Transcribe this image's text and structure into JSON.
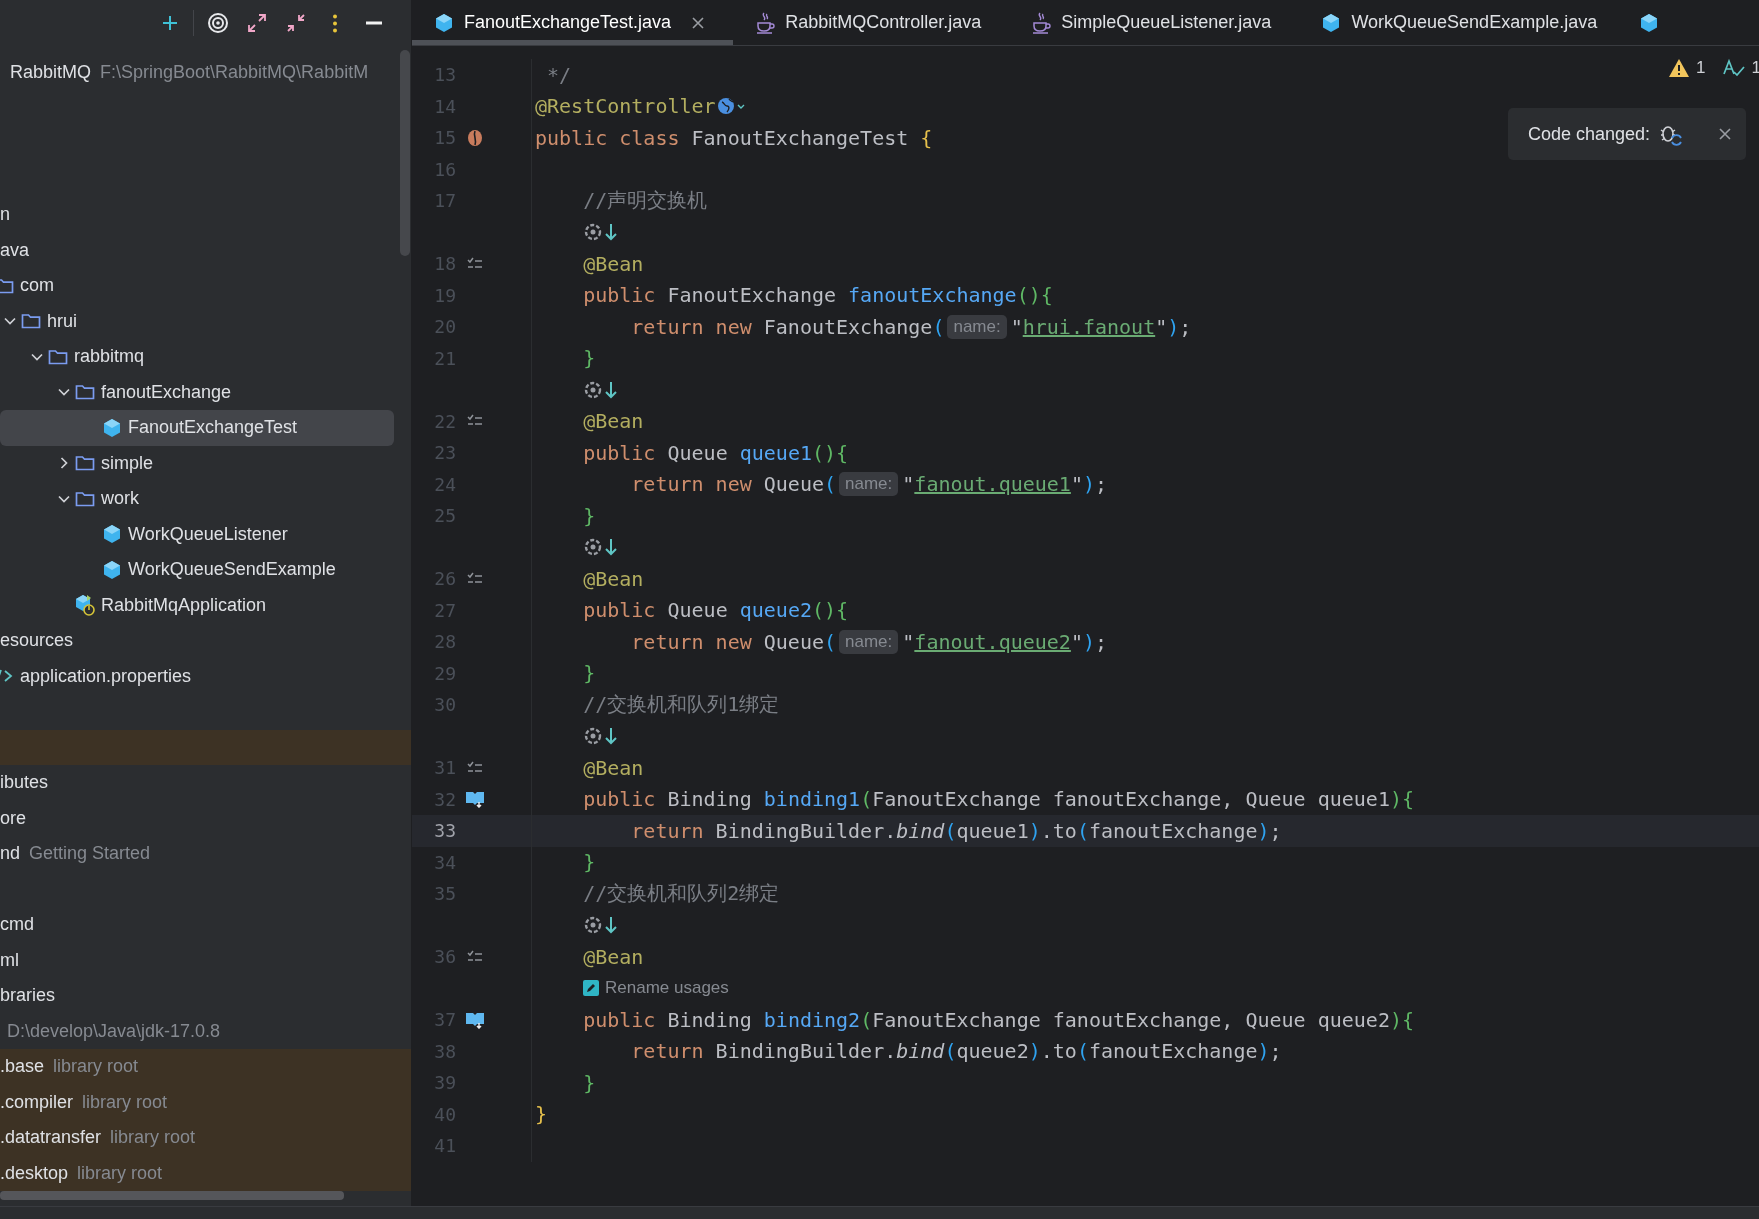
{
  "project": {
    "root": {
      "label": "RabbitMQ",
      "detail": "F:\\SpringBoot\\RabbitMQ\\RabbitM"
    },
    "rows": [
      {
        "excluded": false
      },
      {
        "excluded": false
      },
      {
        "excluded": false
      },
      {
        "label": "n",
        "selected": false,
        "children": [
          {
            "label": "ava",
            "selected": false,
            "children": [
              {
                "label": "com",
                "kind": "folder",
                "selected": false,
                "children": [
                  {
                    "label": "hrui",
                    "kind": "folder",
                    "expanded": true,
                    "selected": false,
                    "children": [
                      {
                        "label": "rabbitmq",
                        "kind": "folder",
                        "expanded": true,
                        "selected": false,
                        "children": [
                          {
                            "label": "fanoutExchange",
                            "kind": "folder",
                            "expanded": true,
                            "selected": false,
                            "children": [
                              {
                                "label": "FanoutExchangeTest",
                                "kind": "class",
                                "selected": true
                              }
                            ]
                          },
                          {
                            "label": "simple",
                            "kind": "folder",
                            "expanded": false,
                            "selected": false
                          },
                          {
                            "label": "work",
                            "kind": "folder",
                            "expanded": true,
                            "selected": false,
                            "children": [
                              {
                                "label": "WorkQueueListener",
                                "kind": "class",
                                "selected": false
                              },
                              {
                                "label": "WorkQueueSendExample",
                                "kind": "class",
                                "selected": false
                              }
                            ]
                          },
                          {
                            "label": "RabbitMqApplication",
                            "kind": "app",
                            "selected": false
                          }
                        ]
                      }
                    ]
                  }
                ]
              }
            ]
          },
          {
            "label": "esources",
            "selected": false,
            "children": [
              {
                "label": "application.properties",
                "kind": "properties",
                "selected": false
              }
            ]
          }
        ]
      },
      {
        "excluded": false
      },
      {
        "excluded": true
      },
      {
        "label": "ibutes",
        "selected": false
      },
      {
        "label": "ore",
        "selected": false
      },
      {
        "label": "nd",
        "detail": "Getting Started",
        "selected": false
      },
      {
        "excluded": false
      },
      {
        "label": "cmd",
        "selected": false
      },
      {
        "label": "ml",
        "selected": false
      },
      {
        "label": "braries",
        "selected": false
      },
      {
        "detail": "D:\\develop\\Java\\jdk-17.0.8",
        "selected": false
      },
      {
        "label": ".base",
        "detail": "library root",
        "excluded": true,
        "selected": false
      },
      {
        "label": ".compiler",
        "detail": "library root",
        "excluded": true,
        "selected": false
      },
      {
        "label": ".datatransfer",
        "detail": "library root",
        "excluded": true,
        "selected": false
      },
      {
        "label": ".desktop",
        "detail": "library root",
        "excluded": true,
        "selected": false
      }
    ]
  },
  "editor": {
    "tabs": [
      {
        "label": "FanoutExchangeTest.java",
        "kind": "class",
        "selected": true,
        "closable": true
      },
      {
        "label": "RabbitMQController.java",
        "kind": "java",
        "selected": false,
        "closable": false
      },
      {
        "label": "SimpleQueueListener.java",
        "kind": "java",
        "selected": false,
        "closable": false
      },
      {
        "label": "WorkQueueSendExample.java",
        "kind": "class",
        "selected": false,
        "closable": false
      },
      {
        "kind": "class",
        "selected": false,
        "closable": false
      }
    ],
    "inspections": [
      {
        "kind": "warning",
        "count": "1"
      },
      {
        "kind": "typo",
        "count": "1"
      }
    ],
    "notification": {
      "text": "Code changed:"
    },
    "lines": [
      {
        "number": "13",
        "tokens": [
          {
            "kind": "comment",
            "text": " */"
          }
        ]
      },
      {
        "number": "14",
        "tokens": [
          {
            "kind": "ann",
            "text": "@RestController"
          },
          {
            "kind": "web-icon"
          }
        ]
      },
      {
        "number": "15",
        "gutter": {
          "kind": "bean"
        },
        "tokens": [
          {
            "kind": "kw",
            "text": "public"
          },
          {
            "kind": "kw",
            "text": " class"
          },
          {
            "kind": "plain",
            "text": " FanoutExchangeTest "
          },
          {
            "kind": "b1",
            "text": "{"
          }
        ]
      },
      {
        "number": "16"
      },
      {
        "number": "17",
        "tokens": [
          {
            "kind": "comment",
            "text": "    //声明交换机"
          }
        ]
      },
      {
        "kind": "inlay"
      },
      {
        "number": "18",
        "gutter": {
          "kind": "list"
        },
        "tokens": [
          {
            "kind": "ann",
            "text": "    @Bean"
          }
        ]
      },
      {
        "number": "19",
        "tokens": [
          {
            "kind": "kw",
            "text": "    public"
          },
          {
            "kind": "plain",
            "text": " FanoutExchange "
          },
          {
            "kind": "fn",
            "text": "fanoutExchange"
          },
          {
            "kind": "b2",
            "text": "(){"
          }
        ]
      },
      {
        "number": "20",
        "tokens": [
          {
            "kind": "kw",
            "text": "        return"
          },
          {
            "kind": "kw",
            "text": " new"
          },
          {
            "kind": "plain",
            "text": " FanoutExchange"
          },
          {
            "kind": "b3",
            "text": "("
          },
          {
            "kind": "hint",
            "text": "name:"
          },
          {
            "kind": "plain",
            "text": "\""
          },
          {
            "kind": "link",
            "text": "hrui.fanout"
          },
          {
            "kind": "plain",
            "text": "\""
          },
          {
            "kind": "b3",
            "text": ")"
          },
          {
            "kind": "plain",
            "text": ";"
          }
        ]
      },
      {
        "number": "21",
        "tokens": [
          {
            "kind": "b2",
            "text": "    }"
          }
        ]
      },
      {
        "kind": "inlay"
      },
      {
        "number": "22",
        "gutter": {
          "kind": "list"
        },
        "tokens": [
          {
            "kind": "ann",
            "text": "    @Bean"
          }
        ]
      },
      {
        "number": "23",
        "tokens": [
          {
            "kind": "kw",
            "text": "    public"
          },
          {
            "kind": "plain",
            "text": " Queue "
          },
          {
            "kind": "fn",
            "text": "queue1"
          },
          {
            "kind": "b2",
            "text": "(){"
          }
        ]
      },
      {
        "number": "24",
        "tokens": [
          {
            "kind": "kw",
            "text": "        return"
          },
          {
            "kind": "kw",
            "text": " new"
          },
          {
            "kind": "plain",
            "text": " Queue"
          },
          {
            "kind": "b3",
            "text": "("
          },
          {
            "kind": "hint",
            "text": "name:"
          },
          {
            "kind": "plain",
            "text": "\""
          },
          {
            "kind": "link",
            "text": "fanout.queue1"
          },
          {
            "kind": "plain",
            "text": "\""
          },
          {
            "kind": "b3",
            "text": ")"
          },
          {
            "kind": "plain",
            "text": ";"
          }
        ]
      },
      {
        "number": "25",
        "tokens": [
          {
            "kind": "b2",
            "text": "    }"
          }
        ]
      },
      {
        "kind": "inlay"
      },
      {
        "number": "26",
        "gutter": {
          "kind": "list"
        },
        "tokens": [
          {
            "kind": "ann",
            "text": "    @Bean"
          }
        ]
      },
      {
        "number": "27",
        "tokens": [
          {
            "kind": "kw",
            "text": "    public"
          },
          {
            "kind": "plain",
            "text": " Queue "
          },
          {
            "kind": "fn",
            "text": "queue2"
          },
          {
            "kind": "b2",
            "text": "(){"
          }
        ]
      },
      {
        "number": "28",
        "tokens": [
          {
            "kind": "kw",
            "text": "        return"
          },
          {
            "kind": "kw",
            "text": " new"
          },
          {
            "kind": "plain",
            "text": " Queue"
          },
          {
            "kind": "b3",
            "text": "("
          },
          {
            "kind": "hint",
            "text": "name:"
          },
          {
            "kind": "plain",
            "text": "\""
          },
          {
            "kind": "link",
            "text": "fanout.queue2"
          },
          {
            "kind": "plain",
            "text": "\""
          },
          {
            "kind": "b3",
            "text": ")"
          },
          {
            "kind": "plain",
            "text": ";"
          }
        ]
      },
      {
        "number": "29",
        "tokens": [
          {
            "kind": "b2",
            "text": "    }"
          }
        ]
      },
      {
        "number": "30",
        "tokens": [
          {
            "kind": "comment",
            "text": "    //交换机和队列1绑定"
          }
        ]
      },
      {
        "kind": "inlay"
      },
      {
        "number": "31",
        "gutter": {
          "kind": "list"
        },
        "tokens": [
          {
            "kind": "ann",
            "text": "    @Bean"
          }
        ]
      },
      {
        "number": "32",
        "gutter": {
          "kind": "book"
        },
        "tokens": [
          {
            "kind": "kw",
            "text": "    public"
          },
          {
            "kind": "plain",
            "text": " Binding "
          },
          {
            "kind": "fn",
            "text": "binding1"
          },
          {
            "kind": "b2",
            "text": "("
          },
          {
            "kind": "plain",
            "text": "FanoutExchange fanoutExchange, Queue queue1"
          },
          {
            "kind": "b2",
            "text": "){"
          }
        ]
      },
      {
        "number": "33",
        "current": true,
        "tokens": [
          {
            "kind": "kw",
            "text": "        return"
          },
          {
            "kind": "plain",
            "text": " BindingBuilder."
          },
          {
            "kind": "static",
            "text": "bind"
          },
          {
            "kind": "b3",
            "text": "("
          },
          {
            "kind": "plain",
            "text": "queue1"
          },
          {
            "kind": "b3",
            "text": ")"
          },
          {
            "kind": "plain",
            "text": ".to"
          },
          {
            "kind": "b3",
            "text": "("
          },
          {
            "kind": "plain",
            "text": "fanoutExchange"
          },
          {
            "kind": "b3",
            "text": ")"
          },
          {
            "kind": "plain",
            "text": ";"
          }
        ]
      },
      {
        "number": "34",
        "tokens": [
          {
            "kind": "b2",
            "text": "    }"
          }
        ]
      },
      {
        "number": "35",
        "tokens": [
          {
            "kind": "comment",
            "text": "    //交换机和队列2绑定"
          }
        ]
      },
      {
        "kind": "inlay"
      },
      {
        "number": "36",
        "gutter": {
          "kind": "list"
        },
        "tokens": [
          {
            "kind": "ann",
            "text": "    @Bean"
          }
        ]
      },
      {
        "kind": "action",
        "text": "Rename usages"
      },
      {
        "number": "37",
        "gutter": {
          "kind": "book"
        },
        "tokens": [
          {
            "kind": "kw",
            "text": "    public"
          },
          {
            "kind": "plain",
            "text": " Binding "
          },
          {
            "kind": "fn",
            "text": "binding2"
          },
          {
            "kind": "b2",
            "text": "("
          },
          {
            "kind": "plain",
            "text": "FanoutExchange fanoutExchange, Queue queue2"
          },
          {
            "kind": "b2",
            "text": "){"
          }
        ]
      },
      {
        "number": "38",
        "tokens": [
          {
            "kind": "kw",
            "text": "        return"
          },
          {
            "kind": "plain",
            "text": " BindingBuilder."
          },
          {
            "kind": "static",
            "text": "bind"
          },
          {
            "kind": "b3",
            "text": "("
          },
          {
            "kind": "plain",
            "text": "queue2"
          },
          {
            "kind": "b3",
            "text": ")"
          },
          {
            "kind": "plain",
            "text": ".to"
          },
          {
            "kind": "b3",
            "text": "("
          },
          {
            "kind": "plain",
            "text": "fanoutExchange"
          },
          {
            "kind": "b3",
            "text": ")"
          },
          {
            "kind": "plain",
            "text": ";"
          }
        ]
      },
      {
        "number": "39",
        "tokens": [
          {
            "kind": "b2",
            "text": "    }"
          }
        ]
      },
      {
        "number": "40",
        "tokens": [
          {
            "kind": "b1",
            "text": "}"
          }
        ]
      },
      {
        "number": "41"
      }
    ]
  }
}
